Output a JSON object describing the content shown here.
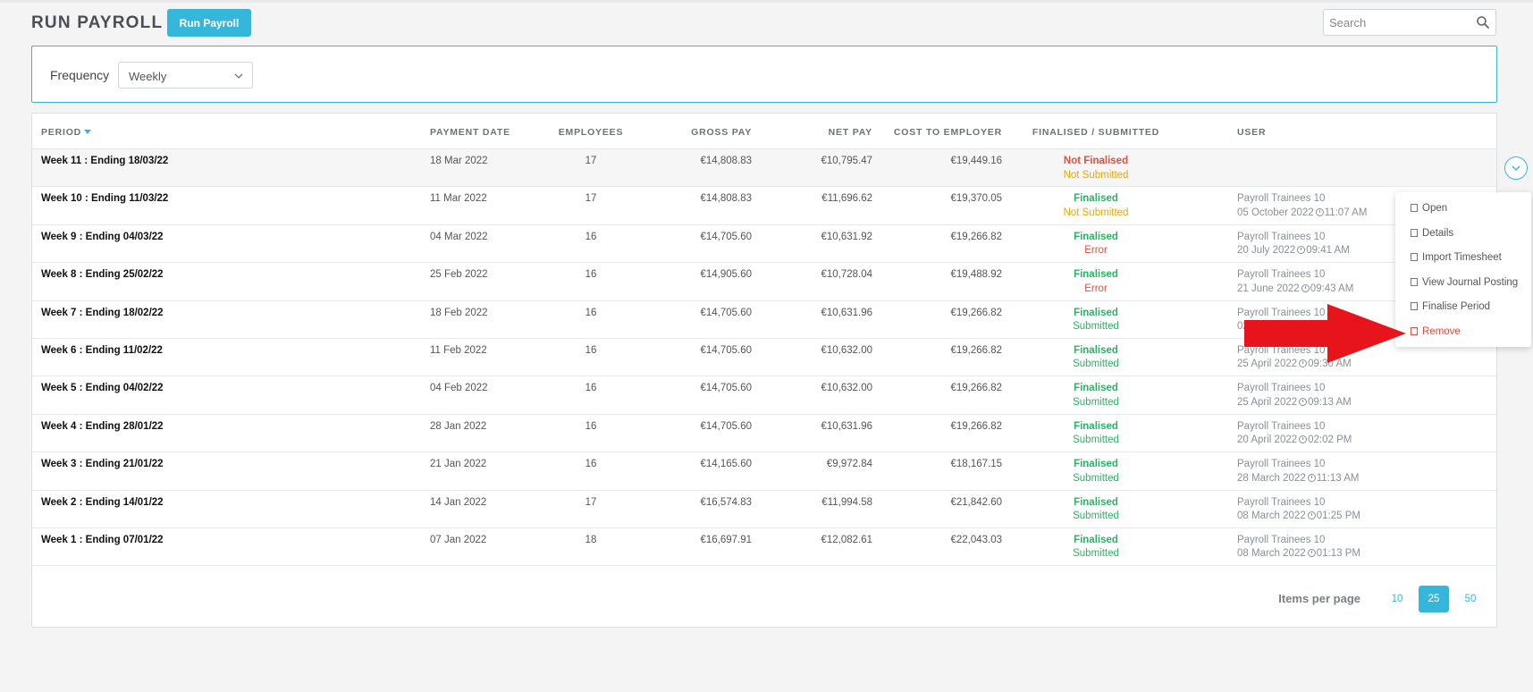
{
  "header": {
    "title": "RUN PAYROLL",
    "run_button": "Run Payroll",
    "search_placeholder": "Search"
  },
  "filter": {
    "label": "Frequency",
    "value": "Weekly"
  },
  "table": {
    "columns": {
      "period": "PERIOD",
      "payment_date": "PAYMENT DATE",
      "employees": "EMPLOYEES",
      "gross_pay": "GROSS PAY",
      "net_pay": "NET PAY",
      "cost": "COST TO EMPLOYER",
      "status": "FINALISED / SUBMITTED",
      "user": "USER"
    },
    "rows": [
      {
        "period": "Week 11 : Ending 18/03/22",
        "date": "18 Mar 2022",
        "employees": "17",
        "gross": "€14,808.83",
        "net": "€10,795.47",
        "cost": "€19,449.16",
        "finalised": "Not Finalised",
        "submitted": "Not Submitted",
        "user": "",
        "user_date": "",
        "user_time": ""
      },
      {
        "period": "Week 10 : Ending 11/03/22",
        "date": "11 Mar 2022",
        "employees": "17",
        "gross": "€14,808.83",
        "net": "€11,696.62",
        "cost": "€19,370.05",
        "finalised": "Finalised",
        "submitted": "Not Submitted",
        "user": "Payroll Trainees 10",
        "user_date": "05 October 2022",
        "user_time": "11:07 AM"
      },
      {
        "period": "Week 9 : Ending 04/03/22",
        "date": "04 Mar 2022",
        "employees": "16",
        "gross": "€14,705.60",
        "net": "€10,631.92",
        "cost": "€19,266.82",
        "finalised": "Finalised",
        "submitted": "Error",
        "user": "Payroll Trainees 10",
        "user_date": "20 July 2022",
        "user_time": "09:41 AM"
      },
      {
        "period": "Week 8 : Ending 25/02/22",
        "date": "25 Feb 2022",
        "employees": "16",
        "gross": "€14,905.60",
        "net": "€10,728.04",
        "cost": "€19,488.92",
        "finalised": "Finalised",
        "submitted": "Error",
        "user": "Payroll Trainees 10",
        "user_date": "21 June 2022",
        "user_time": "09:43 AM"
      },
      {
        "period": "Week 7 : Ending 18/02/22",
        "date": "18 Feb 2022",
        "employees": "16",
        "gross": "€14,705.60",
        "net": "€10,631.96",
        "cost": "€19,266.82",
        "finalised": "Finalised",
        "submitted": "Submitted",
        "user": "Payroll Trainees 10",
        "user_date": "02",
        "user_time": ""
      },
      {
        "period": "Week 6 : Ending 11/02/22",
        "date": "11 Feb 2022",
        "employees": "16",
        "gross": "€14,705.60",
        "net": "€10,632.00",
        "cost": "€19,266.82",
        "finalised": "Finalised",
        "submitted": "Submitted",
        "user": "Payroll Trainees 10",
        "user_date": "25 April 2022",
        "user_time": "09:30 AM"
      },
      {
        "period": "Week 5 : Ending 04/02/22",
        "date": "04 Feb 2022",
        "employees": "16",
        "gross": "€14,705.60",
        "net": "€10,632.00",
        "cost": "€19,266.82",
        "finalised": "Finalised",
        "submitted": "Submitted",
        "user": "Payroll Trainees 10",
        "user_date": "25 April 2022",
        "user_time": "09:13 AM"
      },
      {
        "period": "Week 4 : Ending 28/01/22",
        "date": "28 Jan 2022",
        "employees": "16",
        "gross": "€14,705.60",
        "net": "€10,631.96",
        "cost": "€19,266.82",
        "finalised": "Finalised",
        "submitted": "Submitted",
        "user": "Payroll Trainees 10",
        "user_date": "20 April 2022",
        "user_time": "02:02 PM"
      },
      {
        "period": "Week 3 : Ending 21/01/22",
        "date": "21 Jan 2022",
        "employees": "16",
        "gross": "€14,165.60",
        "net": "€9,972.84",
        "cost": "€18,167.15",
        "finalised": "Finalised",
        "submitted": "Submitted",
        "user": "Payroll Trainees 10",
        "user_date": "28 March 2022",
        "user_time": "11:13 AM"
      },
      {
        "period": "Week 2 : Ending 14/01/22",
        "date": "14 Jan 2022",
        "employees": "17",
        "gross": "€16,574.83",
        "net": "€11,994.58",
        "cost": "€21,842.60",
        "finalised": "Finalised",
        "submitted": "Submitted",
        "user": "Payroll Trainees 10",
        "user_date": "08 March 2022",
        "user_time": "01:25 PM"
      },
      {
        "period": "Week 1 : Ending 07/01/22",
        "date": "07 Jan 2022",
        "employees": "18",
        "gross": "€16,697.91",
        "net": "€12,082.61",
        "cost": "€22,043.03",
        "finalised": "Finalised",
        "submitted": "Submitted",
        "user": "Payroll Trainees 10",
        "user_date": "08 March 2022",
        "user_time": "01:13 PM"
      }
    ]
  },
  "pagination": {
    "label": "Items per page",
    "options": [
      "10",
      "25",
      "50"
    ],
    "active": "25"
  },
  "row_menu": {
    "items": [
      {
        "label": "Open",
        "icon": "calendar-icon"
      },
      {
        "label": "Details",
        "icon": "list-icon"
      },
      {
        "label": "Import Timesheet",
        "icon": "timesheet-icon"
      },
      {
        "label": "View Journal Posting",
        "icon": "document-icon"
      },
      {
        "label": "Finalise Period",
        "icon": "checkbox-icon"
      },
      {
        "label": "Remove",
        "icon": "trash-icon"
      }
    ]
  },
  "colors": {
    "accent": "#35b7dc",
    "finalised": "#28b463",
    "not_finalised": "#e74c3c",
    "not_submitted": "#f0a500",
    "error": "#e74c3c",
    "annotation_arrow": "#e8141c"
  }
}
